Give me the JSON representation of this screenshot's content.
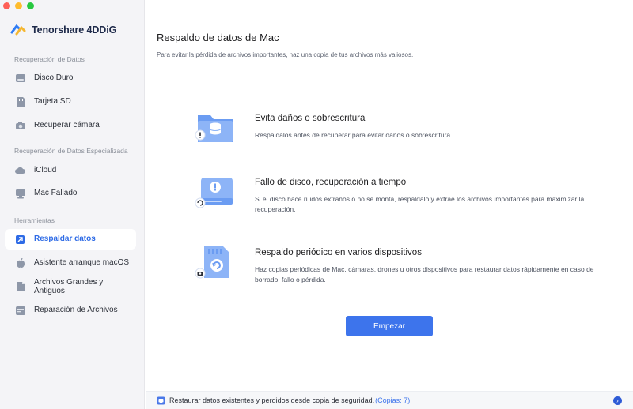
{
  "app": {
    "name": "Tenorshare 4DDiG"
  },
  "sidebar": {
    "sections": [
      {
        "title": "Recuperación de Datos"
      },
      {
        "title": "Recuperación de Datos Especializada"
      },
      {
        "title": "Herramientas"
      }
    ],
    "items": [
      {
        "label": "Disco Duro",
        "icon": "hard-drive-icon"
      },
      {
        "label": "Tarjeta SD",
        "icon": "sd-card-icon"
      },
      {
        "label": "Recuperar cámara",
        "icon": "camera-icon"
      },
      {
        "label": "iCloud",
        "icon": "cloud-icon"
      },
      {
        "label": "Mac Fallado",
        "icon": "crashed-mac-icon"
      },
      {
        "label": "Respaldar datos",
        "icon": "backup-icon",
        "active": true
      },
      {
        "label": "Asistente arranque macOS",
        "icon": "apple-icon"
      },
      {
        "label": "Archivos Grandes y Antiguos",
        "icon": "files-icon"
      },
      {
        "label": "Reparación de Archivos",
        "icon": "repair-icon"
      }
    ]
  },
  "main": {
    "title": "Respaldo de datos de Mac",
    "subtitle": "Para evitar la pérdida de archivos importantes, haz una copia de tus archivos más valiosos.",
    "features": [
      {
        "title": "Evita daños o sobrescritura",
        "desc": "Respáldalos antes de recuperar para evitar daños o sobrescritura.",
        "icon": "folder-database-icon"
      },
      {
        "title": "Fallo de disco, recuperación a tiempo",
        "desc": "Si el disco hace ruidos extraños o no se monta, respáldalo y extrae los archivos importantes para maximizar la recuperación.",
        "icon": "disk-warning-icon"
      },
      {
        "title": "Respaldo periódico en varios dispositivos",
        "desc": "Haz copias periódicas de Mac, cámaras, drones u otros dispositivos para restaurar datos rápidamente en caso de borrado, fallo o pérdida.",
        "icon": "sd-sync-icon"
      }
    ],
    "start_label": "Empezar"
  },
  "footer": {
    "text": "Restaurar datos existentes y perdidos desde copia de seguridad.",
    "link": "(Copias: 7)"
  },
  "colors": {
    "accent": "#3d74ec",
    "sidebar_bg": "#f4f4f7",
    "icon_blue": "#6b9cf2"
  }
}
